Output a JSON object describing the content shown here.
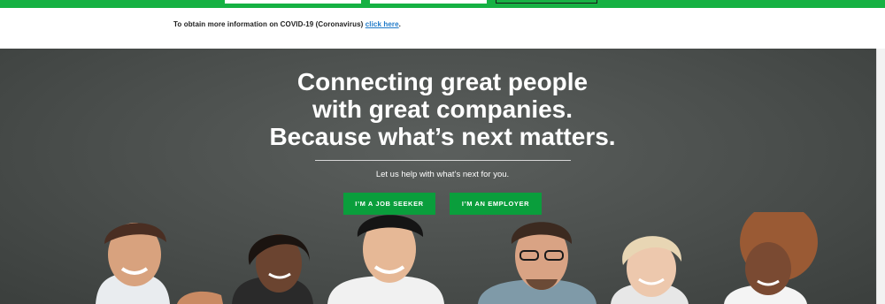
{
  "notice": {
    "text": "To obtain more information on COVID-19 (Coronavirus)",
    "link_label": "click here",
    "trailing": "."
  },
  "hero": {
    "headline": [
      "Connecting great people",
      "with great companies.",
      "Because what’s next matters."
    ],
    "subtext": "Let us help with what’s next for you.",
    "buttons": {
      "job_seeker": "I’M A JOB SEEKER",
      "employer": "I’M AN EMPLOYER"
    }
  },
  "colors": {
    "brand_green": "#16b143",
    "button_green": "#0a9e3c",
    "link_blue": "#1e79c8",
    "hero_bg": "#4a4e4c"
  },
  "icons": [
    "people-photo-illustration"
  ]
}
